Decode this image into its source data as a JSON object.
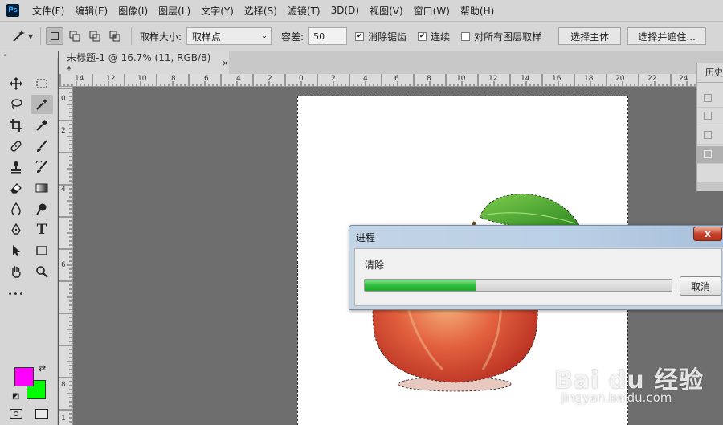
{
  "menubar": {
    "logo_text": "Ps",
    "items": [
      "文件(F)",
      "编辑(E)",
      "图像(I)",
      "图层(L)",
      "文字(Y)",
      "选择(S)",
      "滤镜(T)",
      "3D(D)",
      "视图(V)",
      "窗口(W)",
      "帮助(H)"
    ]
  },
  "options": {
    "sample_size_label": "取样大小:",
    "sample_size_value": "取样点",
    "tolerance_label": "容差:",
    "tolerance_value": "50",
    "anti_alias_label": "消除锯齿",
    "anti_alias_checked": true,
    "contiguous_label": "连续",
    "contiguous_checked": true,
    "sample_all_layers_label": "对所有图层取样",
    "sample_all_layers_checked": false,
    "select_subject_label": "选择主体",
    "select_and_mask_label": "选择并遮住..."
  },
  "document": {
    "tab_title": "未标题-1 @ 16.7% (11, RGB/8) *",
    "tab_close": "×"
  },
  "rulers": {
    "top": [
      "14",
      "12",
      "10",
      "8",
      "6",
      "4",
      "2",
      "0",
      "2",
      "4",
      "6",
      "8",
      "10",
      "12",
      "14",
      "16",
      "18",
      "20",
      "22",
      "24"
    ],
    "left": [
      "0",
      "2",
      "4",
      "6",
      "8",
      "1"
    ]
  },
  "history_panel": {
    "title": "历史"
  },
  "dialog": {
    "title": "进程",
    "close_label": "x",
    "message": "清除",
    "progress": 0.36,
    "cancel_label": "取消"
  },
  "colors": {
    "foreground": "#ff00ff",
    "background": "#00ff00",
    "progress_green": "#2fbf3c"
  },
  "watermark": {
    "brand": "Bai du 经验",
    "url": "jingyan.baidu.com"
  },
  "tools": {
    "type_tool_glyph": "T",
    "more_glyph": "•••"
  }
}
